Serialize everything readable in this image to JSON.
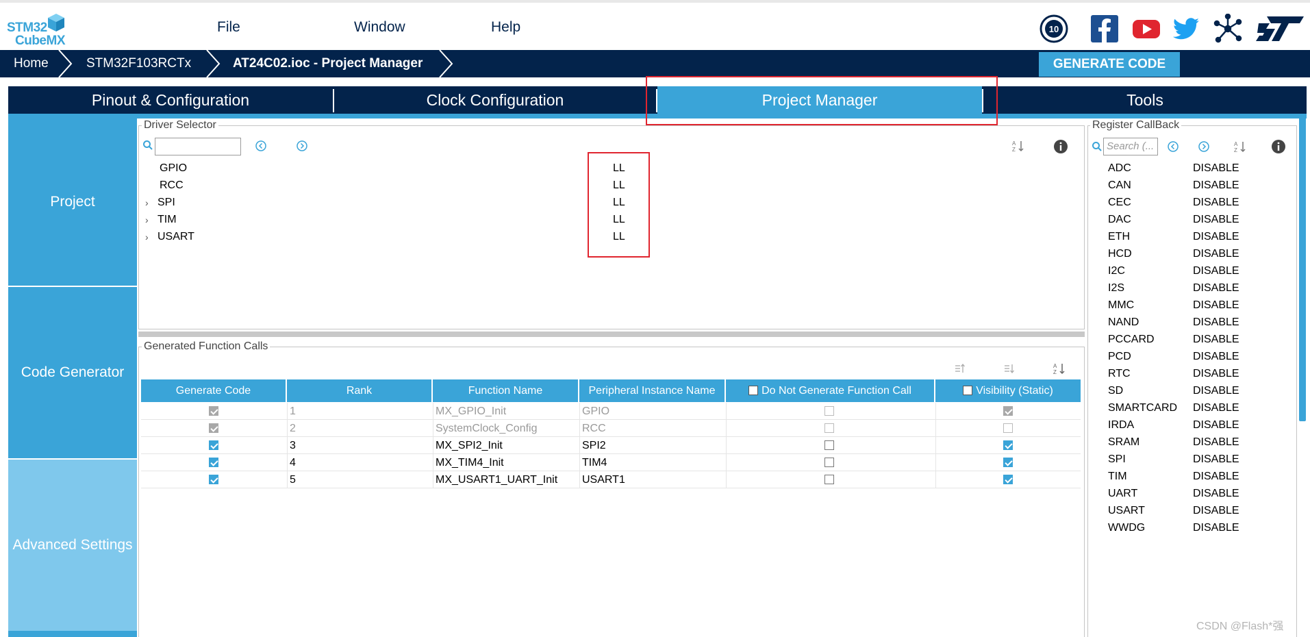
{
  "menu": {
    "file": "File",
    "window": "Window",
    "help": "Help"
  },
  "logo": {
    "line1": "STM32",
    "line2": "CubeMX"
  },
  "social": [
    "anniversary-10-icon",
    "facebook-icon",
    "youtube-icon",
    "twitter-icon",
    "network-icon",
    "st-logo-icon"
  ],
  "breadcrumb": [
    "Home",
    "STM32F103RCTx",
    "AT24C02.ioc - Project Manager"
  ],
  "generate_code": "GENERATE CODE",
  "tabs": [
    "Pinout & Configuration",
    "Clock Configuration",
    "Project Manager",
    "Tools"
  ],
  "sidebar": [
    "Project",
    "Code Generator",
    "Advanced Settings"
  ],
  "driver_selector": {
    "legend": "Driver Selector",
    "rows": [
      {
        "name": "GPIO",
        "value": "LL"
      },
      {
        "name": "RCC",
        "value": "LL"
      },
      {
        "name": "SPI",
        "value": "LL"
      },
      {
        "name": "TIM",
        "value": "LL"
      },
      {
        "name": "USART",
        "value": "LL"
      }
    ]
  },
  "function_calls": {
    "legend": "Generated Function Calls",
    "headers": [
      "Generate Code",
      "Rank",
      "Function Name",
      "Peripheral Instance Name",
      "Do Not Generate Function Call",
      "Visibility (Static)"
    ],
    "rows": [
      {
        "rank": "1",
        "func": "MX_GPIO_Init",
        "inst": "GPIO"
      },
      {
        "rank": "2",
        "func": "SystemClock_Config",
        "inst": "RCC"
      },
      {
        "rank": "3",
        "func": "MX_SPI2_Init",
        "inst": "SPI2"
      },
      {
        "rank": "4",
        "func": "MX_TIM4_Init",
        "inst": "TIM4"
      },
      {
        "rank": "5",
        "func": "MX_USART1_UART_Init",
        "inst": "USART1"
      }
    ]
  },
  "register_callback": {
    "legend": "Register CallBack",
    "search_placeholder": "Search (...",
    "rows": [
      {
        "name": "ADC",
        "value": "DISABLE"
      },
      {
        "name": "CAN",
        "value": "DISABLE"
      },
      {
        "name": "CEC",
        "value": "DISABLE"
      },
      {
        "name": "DAC",
        "value": "DISABLE"
      },
      {
        "name": "ETH",
        "value": "DISABLE"
      },
      {
        "name": "HCD",
        "value": "DISABLE"
      },
      {
        "name": "I2C",
        "value": "DISABLE"
      },
      {
        "name": "I2S",
        "value": "DISABLE"
      },
      {
        "name": "MMC",
        "value": "DISABLE"
      },
      {
        "name": "NAND",
        "value": "DISABLE"
      },
      {
        "name": "PCCARD",
        "value": "DISABLE"
      },
      {
        "name": "PCD",
        "value": "DISABLE"
      },
      {
        "name": "RTC",
        "value": "DISABLE"
      },
      {
        "name": "SD",
        "value": "DISABLE"
      },
      {
        "name": "SMARTCARD",
        "value": "DISABLE"
      },
      {
        "name": "IRDA",
        "value": "DISABLE"
      },
      {
        "name": "SRAM",
        "value": "DISABLE"
      },
      {
        "name": "SPI",
        "value": "DISABLE"
      },
      {
        "name": "TIM",
        "value": "DISABLE"
      },
      {
        "name": "UART",
        "value": "DISABLE"
      },
      {
        "name": "USART",
        "value": "DISABLE"
      },
      {
        "name": "WWDG",
        "value": "DISABLE"
      }
    ]
  },
  "watermark": "CSDN @Flash*强",
  "colors": {
    "navy": "#03234b",
    "accent": "#3aa4d8",
    "sidebar_light": "#7fc8ec",
    "highlight": "#e0252f"
  }
}
